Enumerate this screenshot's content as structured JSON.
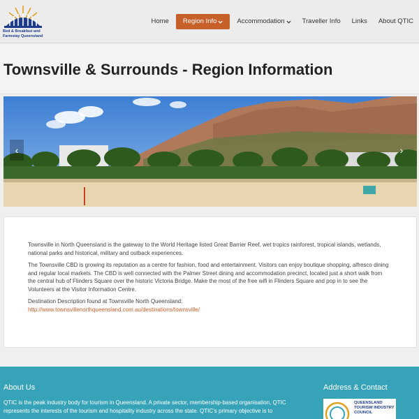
{
  "header": {
    "logo_lines": [
      "Bed & Breakfast and",
      "Farmstay Queensland"
    ],
    "nav": [
      {
        "label": "Home",
        "dropdown": false,
        "active": false
      },
      {
        "label": "Region Info",
        "dropdown": true,
        "active": true
      },
      {
        "label": "Accommodation",
        "dropdown": true,
        "active": false
      },
      {
        "label": "Traveller Info",
        "dropdown": false,
        "active": false
      },
      {
        "label": "Links",
        "dropdown": false,
        "active": false
      },
      {
        "label": "About QTIC",
        "dropdown": false,
        "active": false
      }
    ]
  },
  "page": {
    "title": "Townsville & Surrounds - Region Information"
  },
  "hero": {
    "prev_symbol": "‹",
    "next_symbol": "›"
  },
  "content": {
    "para1": "Townsville in North Queensland is the gateway to the World Heritage listed Great Barrier Reef, wet tropics rainforest, tropical islands, wetlands, national parks and historical, military and outback experiences.",
    "para2": "The Townsville CBD is growing its reputation as a centre for fashion, food and entertainment. Visitors can enjoy boutique shopping, alfresco dining and regular local markets. The CBD is well connected with the Palmer Street dining and accommodation precinct, located just a short walk from the central hub of Flinders Square over the historic Victoria Bridge. Make the most of the free wifi in Flinders Square and pop in to see the Volunteers at the Visitor Information Centre.",
    "source_label": "Destination Description found at Townsville North Queensland:",
    "source_link": "http://www.townsvillenorthqueensland.com.au/destinations/townsville/"
  },
  "footer": {
    "about_heading": "About Us",
    "about_text": "QTIC is the peak industry body for tourism in Queensland. A private sector, membership-based organisation, QTIC represents the interests of the tourism and hospitality industry across the state. QTIC’s primary objective is to",
    "address_heading": "Address & Contact",
    "qtic_logo_lines": [
      "QUEENSLAND",
      "TOURISM INDUSTRY",
      "COUNCIL"
    ]
  },
  "colors": {
    "accent": "#c8602a",
    "footer_bg": "#36a3b8",
    "logo_blue": "#1d3c8c"
  }
}
